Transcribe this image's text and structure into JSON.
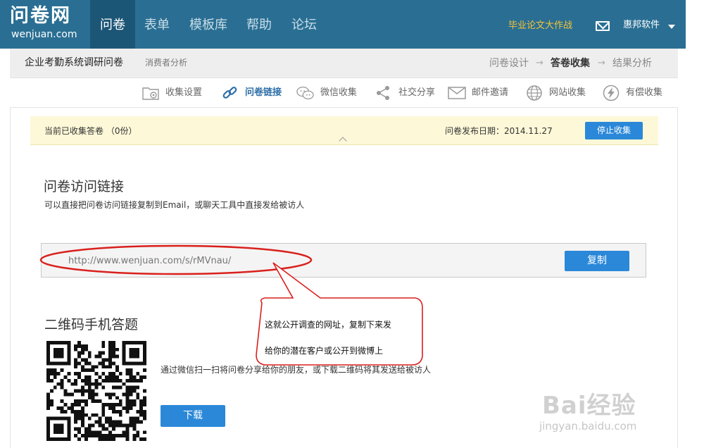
{
  "brand": {
    "logo_cn": "问卷网",
    "logo_en": "wenjuan.com"
  },
  "nav": {
    "items": [
      {
        "label": "问卷",
        "active": true
      },
      {
        "label": "表单",
        "active": false
      },
      {
        "label": "模板库",
        "active": false
      },
      {
        "label": "帮助",
        "active": false
      },
      {
        "label": "论坛",
        "active": false
      }
    ],
    "promo": "毕业论文大作战",
    "user": "惠邦软件"
  },
  "subheader": {
    "survey_title": "企业考勤系统调研问卷",
    "survey_subtitle": "消费者分析",
    "steps": [
      {
        "label": "问卷设计",
        "active": false
      },
      {
        "label": "答卷收集",
        "active": true
      },
      {
        "label": "结果分析",
        "active": false
      }
    ],
    "step_arrow": "→"
  },
  "toolbar": {
    "items": [
      {
        "label": "收集设置",
        "icon": "settings-folder-icon",
        "active": false
      },
      {
        "label": "问卷链接",
        "icon": "link-icon",
        "active": true
      },
      {
        "label": "微信收集",
        "icon": "wechat-icon",
        "active": false
      },
      {
        "label": "社交分享",
        "icon": "share-icon",
        "active": false
      },
      {
        "label": "邮件邀请",
        "icon": "mail-icon",
        "active": false
      },
      {
        "label": "网站收集",
        "icon": "globe-icon",
        "active": false
      },
      {
        "label": "有偿收集",
        "icon": "lightning-icon",
        "active": false
      }
    ]
  },
  "notice": {
    "collected": "当前已收集答卷 （0份）",
    "publish_date": "问卷发布日期：2014.11.27",
    "stop_button": "停止收集"
  },
  "link_section": {
    "title": "问卷访问链接",
    "description": "可以直接把问卷访问链接复制到Email，或聊天工具中直接发给被访人",
    "url": "http://www.wenjuan.com/s/rMVnau/",
    "copy_button": "复制"
  },
  "qr_section": {
    "title": "二维码手机答题",
    "description": "通过微信扫一扫将问卷分享给你的朋友，或下载二维码将其发送给被访人",
    "download_button": "下载"
  },
  "annotation": {
    "line1": "这就公开调查的网址，复制下来发",
    "line2": "给你的潜在客户或公开到微博上",
    "color": "#d9201c"
  },
  "watermark": {
    "brand": "Bai经验",
    "url": "jingyan.baidu.com"
  },
  "colors": {
    "nav_bg": "#2a6f93",
    "nav_active": "#1c5677",
    "button_blue": "#2b88d8",
    "promo": "#f5c338",
    "notice_bg": "#fdf8d8"
  }
}
